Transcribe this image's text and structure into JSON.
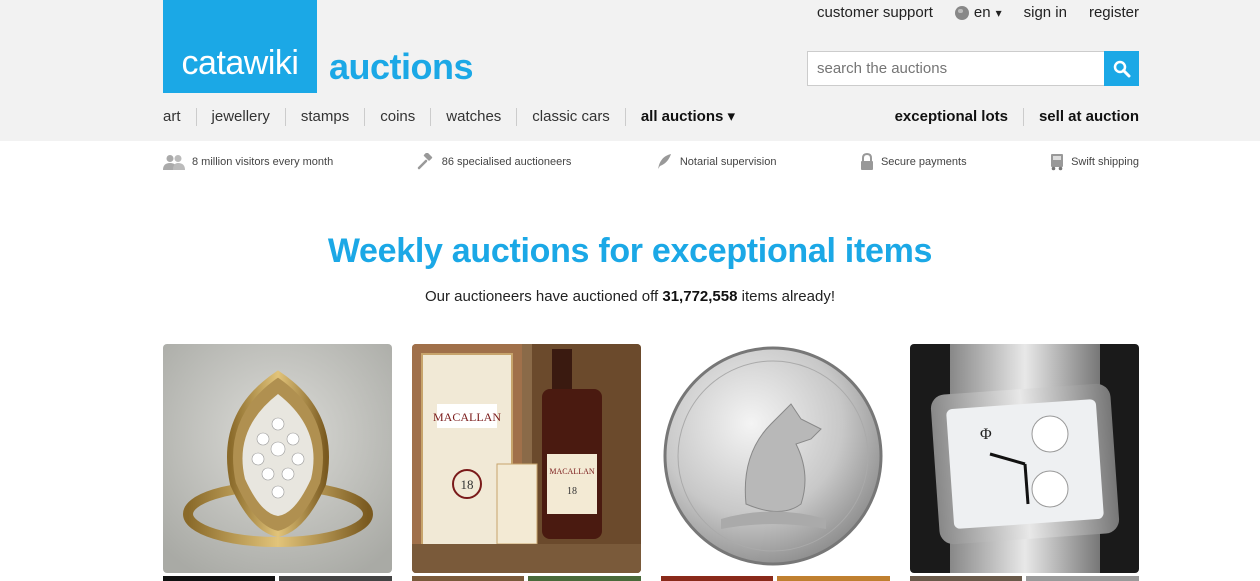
{
  "brand": {
    "logo_bold": "cata",
    "logo_thin": "wiki",
    "name": "auctions"
  },
  "top_nav": {
    "support": "customer support",
    "language": "en",
    "language_caret": "▾",
    "signin": "sign in",
    "register": "register"
  },
  "search": {
    "placeholder": "search the auctions"
  },
  "categories": [
    {
      "label": "art"
    },
    {
      "label": "jewellery"
    },
    {
      "label": "stamps"
    },
    {
      "label": "coins"
    },
    {
      "label": "watches"
    },
    {
      "label": "classic cars"
    },
    {
      "label": "all auctions ▾"
    }
  ],
  "right_nav": {
    "exceptional": "exceptional lots",
    "sell": "sell at auction"
  },
  "features": [
    {
      "icon": "visitors-icon",
      "label": "8 million visitors every month"
    },
    {
      "icon": "gavel-icon",
      "label": "86 specialised auctioneers"
    },
    {
      "icon": "quill-icon",
      "label": "Notarial supervision"
    },
    {
      "icon": "lock-icon",
      "label": "Secure payments"
    },
    {
      "icon": "truck-icon",
      "label": "Swift shipping"
    }
  ],
  "hero": {
    "title": "Weekly auctions for exceptional items",
    "subtitle_before": "Our auctioneers have auctioned off ",
    "count": "31,772,558",
    "subtitle_after": " items already!"
  },
  "cards": [
    {
      "name": "jewellery-ring-card"
    },
    {
      "name": "whisky-card"
    },
    {
      "name": "silver-coin-card"
    },
    {
      "name": "watch-card"
    }
  ],
  "colors": {
    "accent": "#1ba8e6",
    "header_bg": "#f2f2f2"
  }
}
